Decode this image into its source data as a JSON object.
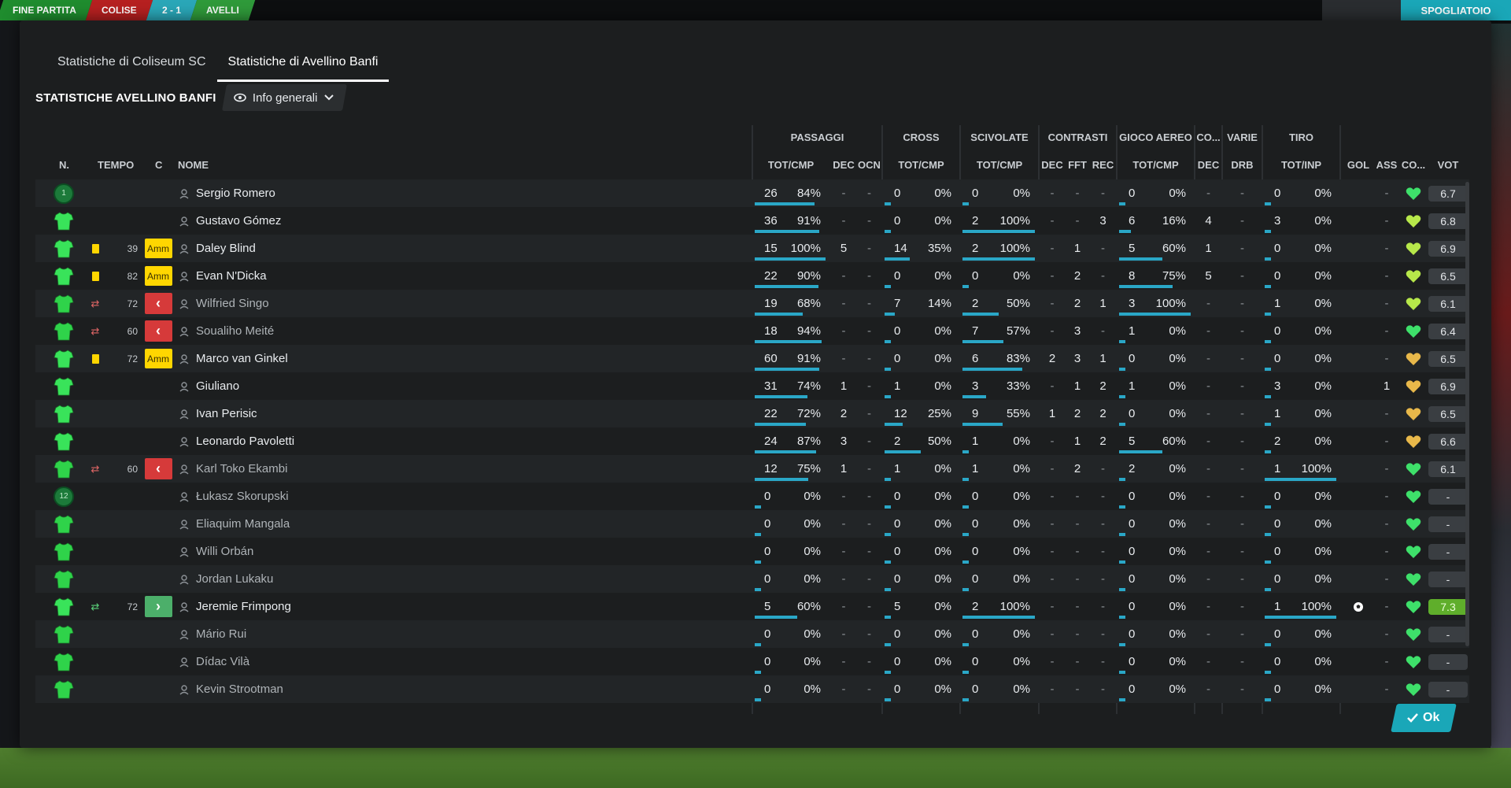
{
  "background": {
    "scoreboard": [
      "FINE PARTITA",
      "COLISE",
      "2 - 1",
      "AVELLI"
    ],
    "right_button": "SPOGLIATOIO"
  },
  "tabs": [
    {
      "label": "Statistiche di Coliseum SC",
      "active": false
    },
    {
      "label": "Statistiche di Avellino Banfi",
      "active": true
    }
  ],
  "section_title": "STATISTICHE AVELLINO BANFI",
  "view_dropdown": {
    "label": "Info generali"
  },
  "group_headers": {
    "passaggi": "PASSAGGI",
    "cross": "CROSS",
    "scivolate": "SCIVOLATE",
    "contrasti": "CONTRASTI",
    "gioco_aereo": "GIOCO AEREO",
    "co": "CO...",
    "varie": "VARIE",
    "tiro": "TIRO"
  },
  "column_headers": {
    "n": "N.",
    "tempo": "TEMPO",
    "c": "C",
    "nome": "NOME",
    "pass_totcmp": "TOT/CMP",
    "pass_dec": "DEC",
    "pass_ocn": "OCN",
    "cross_totcmp": "TOT/CMP",
    "sciv_totcmp": "TOT/CMP",
    "contr_dec": "DEC",
    "contr_fft": "FFT",
    "contr_rec": "REC",
    "aereo_totcmp": "TOT/CMP",
    "co_dec": "DEC",
    "varie_drb": "DRB",
    "tiro_totinp": "TOT/INP",
    "gol": "GOL",
    "ass": "ASS",
    "co2": "CO...",
    "vot": "VOT"
  },
  "players": [
    {
      "num": "1",
      "gk": true,
      "card": "",
      "minute": "",
      "badge": "",
      "name": "Sergio Romero",
      "pass": [
        "26",
        "84%"
      ],
      "pass_pct": 0.84,
      "pdec": "-",
      "ocn": "-",
      "cross": [
        "0",
        "0%"
      ],
      "cross_pct": 0,
      "sciv": [
        "0",
        "0%"
      ],
      "sciv_pct": 0,
      "cdec": "-",
      "fft": "-",
      "rec": "-",
      "aereo": [
        "0",
        "0%"
      ],
      "aereo_pct": 0,
      "codec": "-",
      "drb": "-",
      "tiro": [
        "0",
        "0%"
      ],
      "tiro_pct": 0,
      "gol": "",
      "ass": "-",
      "heart": "green",
      "vot": "6.7",
      "dim": false
    },
    {
      "num": "",
      "gk": false,
      "card": "",
      "minute": "",
      "badge": "",
      "name": "Gustavo Gómez",
      "pass": [
        "36",
        "91%"
      ],
      "pass_pct": 0.91,
      "pdec": "-",
      "ocn": "-",
      "cross": [
        "0",
        "0%"
      ],
      "cross_pct": 0,
      "sciv": [
        "2",
        "100%"
      ],
      "sciv_pct": 1,
      "cdec": "-",
      "fft": "-",
      "rec": "3",
      "aereo": [
        "6",
        "16%"
      ],
      "aereo_pct": 0.16,
      "codec": "4",
      "drb": "-",
      "tiro": [
        "3",
        "0%"
      ],
      "tiro_pct": 0,
      "gol": "",
      "ass": "-",
      "heart": "lime",
      "vot": "6.8",
      "dim": false
    },
    {
      "num": "",
      "gk": false,
      "card": "yellow",
      "minute": "39",
      "badge": "Amm",
      "name": "Daley Blind",
      "pass": [
        "15",
        "100%"
      ],
      "pass_pct": 1,
      "pdec": "5",
      "ocn": "-",
      "cross": [
        "14",
        "35%"
      ],
      "cross_pct": 0.35,
      "sciv": [
        "2",
        "100%"
      ],
      "sciv_pct": 1,
      "cdec": "-",
      "fft": "1",
      "rec": "-",
      "aereo": [
        "5",
        "60%"
      ],
      "aereo_pct": 0.6,
      "codec": "1",
      "drb": "-",
      "tiro": [
        "0",
        "0%"
      ],
      "tiro_pct": 0,
      "gol": "",
      "ass": "-",
      "heart": "lime",
      "vot": "6.9",
      "dim": false
    },
    {
      "num": "",
      "gk": false,
      "card": "yellow",
      "minute": "82",
      "badge": "Amm",
      "name": "Evan N'Dicka",
      "pass": [
        "22",
        "90%"
      ],
      "pass_pct": 0.9,
      "pdec": "-",
      "ocn": "-",
      "cross": [
        "0",
        "0%"
      ],
      "cross_pct": 0,
      "sciv": [
        "0",
        "0%"
      ],
      "sciv_pct": 0,
      "cdec": "-",
      "fft": "2",
      "rec": "-",
      "aereo": [
        "8",
        "75%"
      ],
      "aereo_pct": 0.75,
      "codec": "5",
      "drb": "-",
      "tiro": [
        "0",
        "0%"
      ],
      "tiro_pct": 0,
      "gol": "",
      "ass": "-",
      "heart": "lime",
      "vot": "6.5",
      "dim": false
    },
    {
      "num": "",
      "gk": false,
      "card": "subout",
      "minute": "72",
      "badge": "out",
      "name": "Wilfried Singo",
      "pass": [
        "19",
        "68%"
      ],
      "pass_pct": 0.68,
      "pdec": "-",
      "ocn": "-",
      "cross": [
        "7",
        "14%"
      ],
      "cross_pct": 0.14,
      "sciv": [
        "2",
        "50%"
      ],
      "sciv_pct": 0.5,
      "cdec": "-",
      "fft": "2",
      "rec": "1",
      "aereo": [
        "3",
        "100%"
      ],
      "aereo_pct": 1,
      "codec": "-",
      "drb": "-",
      "tiro": [
        "1",
        "0%"
      ],
      "tiro_pct": 0,
      "gol": "",
      "ass": "-",
      "heart": "lime",
      "vot": "6.1",
      "dim": true
    },
    {
      "num": "",
      "gk": false,
      "card": "subout",
      "minute": "60",
      "badge": "out",
      "name": "Soualiho Meité",
      "pass": [
        "18",
        "94%"
      ],
      "pass_pct": 0.94,
      "pdec": "-",
      "ocn": "-",
      "cross": [
        "0",
        "0%"
      ],
      "cross_pct": 0,
      "sciv": [
        "7",
        "57%"
      ],
      "sciv_pct": 0.57,
      "cdec": "-",
      "fft": "3",
      "rec": "-",
      "aereo": [
        "1",
        "0%"
      ],
      "aereo_pct": 0,
      "codec": "-",
      "drb": "-",
      "tiro": [
        "0",
        "0%"
      ],
      "tiro_pct": 0,
      "gol": "",
      "ass": "-",
      "heart": "green",
      "vot": "6.4",
      "dim": true
    },
    {
      "num": "",
      "gk": false,
      "card": "yellow",
      "minute": "72",
      "badge": "Amm",
      "name": "Marco van Ginkel",
      "pass": [
        "60",
        "91%"
      ],
      "pass_pct": 0.91,
      "pdec": "-",
      "ocn": "-",
      "cross": [
        "0",
        "0%"
      ],
      "cross_pct": 0,
      "sciv": [
        "6",
        "83%"
      ],
      "sciv_pct": 0.83,
      "cdec": "2",
      "fft": "3",
      "rec": "1",
      "aereo": [
        "0",
        "0%"
      ],
      "aereo_pct": 0,
      "codec": "-",
      "drb": "-",
      "tiro": [
        "0",
        "0%"
      ],
      "tiro_pct": 0,
      "gol": "",
      "ass": "-",
      "heart": "gold",
      "vot": "6.5",
      "dim": false
    },
    {
      "num": "",
      "gk": false,
      "card": "",
      "minute": "",
      "badge": "",
      "name": "Giuliano",
      "pass": [
        "31",
        "74%"
      ],
      "pass_pct": 0.74,
      "pdec": "1",
      "ocn": "-",
      "cross": [
        "1",
        "0%"
      ],
      "cross_pct": 0,
      "sciv": [
        "3",
        "33%"
      ],
      "sciv_pct": 0.33,
      "cdec": "-",
      "fft": "1",
      "rec": "2",
      "aereo": [
        "1",
        "0%"
      ],
      "aereo_pct": 0,
      "codec": "-",
      "drb": "-",
      "tiro": [
        "3",
        "0%"
      ],
      "tiro_pct": 0,
      "gol": "",
      "ass": "1",
      "heart": "gold",
      "vot": "6.9",
      "dim": false
    },
    {
      "num": "",
      "gk": false,
      "card": "",
      "minute": "",
      "badge": "",
      "name": "Ivan Perisic",
      "pass": [
        "22",
        "72%"
      ],
      "pass_pct": 0.72,
      "pdec": "2",
      "ocn": "-",
      "cross": [
        "12",
        "25%"
      ],
      "cross_pct": 0.25,
      "sciv": [
        "9",
        "55%"
      ],
      "sciv_pct": 0.55,
      "cdec": "1",
      "fft": "2",
      "rec": "2",
      "aereo": [
        "0",
        "0%"
      ],
      "aereo_pct": 0,
      "codec": "-",
      "drb": "-",
      "tiro": [
        "1",
        "0%"
      ],
      "tiro_pct": 0,
      "gol": "",
      "ass": "-",
      "heart": "gold",
      "vot": "6.5",
      "dim": false
    },
    {
      "num": "",
      "gk": false,
      "card": "",
      "minute": "",
      "badge": "",
      "name": "Leonardo Pavoletti",
      "pass": [
        "24",
        "87%"
      ],
      "pass_pct": 0.87,
      "pdec": "3",
      "ocn": "-",
      "cross": [
        "2",
        "50%"
      ],
      "cross_pct": 0.5,
      "sciv": [
        "1",
        "0%"
      ],
      "sciv_pct": 0,
      "cdec": "-",
      "fft": "1",
      "rec": "2",
      "aereo": [
        "5",
        "60%"
      ],
      "aereo_pct": 0.6,
      "codec": "-",
      "drb": "-",
      "tiro": [
        "2",
        "0%"
      ],
      "tiro_pct": 0,
      "gol": "",
      "ass": "-",
      "heart": "gold",
      "vot": "6.6",
      "dim": false
    },
    {
      "num": "",
      "gk": false,
      "card": "subout",
      "minute": "60",
      "badge": "out",
      "name": "Karl Toko Ekambi",
      "pass": [
        "12",
        "75%"
      ],
      "pass_pct": 0.75,
      "pdec": "1",
      "ocn": "-",
      "cross": [
        "1",
        "0%"
      ],
      "cross_pct": 0,
      "sciv": [
        "1",
        "0%"
      ],
      "sciv_pct": 0,
      "cdec": "-",
      "fft": "2",
      "rec": "-",
      "aereo": [
        "2",
        "0%"
      ],
      "aereo_pct": 0,
      "codec": "-",
      "drb": "-",
      "tiro": [
        "1",
        "100%"
      ],
      "tiro_pct": 1,
      "gol": "",
      "ass": "-",
      "heart": "green",
      "vot": "6.1",
      "dim": true
    },
    {
      "num": "12",
      "gk": true,
      "card": "",
      "minute": "",
      "badge": "",
      "name": "Łukasz Skorupski",
      "pass": [
        "0",
        "0%"
      ],
      "pass_pct": 0,
      "pdec": "-",
      "ocn": "-",
      "cross": [
        "0",
        "0%"
      ],
      "cross_pct": 0,
      "sciv": [
        "0",
        "0%"
      ],
      "sciv_pct": 0,
      "cdec": "-",
      "fft": "-",
      "rec": "-",
      "aereo": [
        "0",
        "0%"
      ],
      "aereo_pct": 0,
      "codec": "-",
      "drb": "-",
      "tiro": [
        "0",
        "0%"
      ],
      "tiro_pct": 0,
      "gol": "",
      "ass": "-",
      "heart": "green",
      "vot": "-",
      "dim": true
    },
    {
      "num": "",
      "gk": false,
      "card": "",
      "minute": "",
      "badge": "",
      "name": "Eliaquim Mangala",
      "pass": [
        "0",
        "0%"
      ],
      "pass_pct": 0,
      "pdec": "-",
      "ocn": "-",
      "cross": [
        "0",
        "0%"
      ],
      "cross_pct": 0,
      "sciv": [
        "0",
        "0%"
      ],
      "sciv_pct": 0,
      "cdec": "-",
      "fft": "-",
      "rec": "-",
      "aereo": [
        "0",
        "0%"
      ],
      "aereo_pct": 0,
      "codec": "-",
      "drb": "-",
      "tiro": [
        "0",
        "0%"
      ],
      "tiro_pct": 0,
      "gol": "",
      "ass": "-",
      "heart": "green",
      "vot": "-",
      "dim": true
    },
    {
      "num": "",
      "gk": false,
      "card": "",
      "minute": "",
      "badge": "",
      "name": "Willi Orbán",
      "pass": [
        "0",
        "0%"
      ],
      "pass_pct": 0,
      "pdec": "-",
      "ocn": "-",
      "cross": [
        "0",
        "0%"
      ],
      "cross_pct": 0,
      "sciv": [
        "0",
        "0%"
      ],
      "sciv_pct": 0,
      "cdec": "-",
      "fft": "-",
      "rec": "-",
      "aereo": [
        "0",
        "0%"
      ],
      "aereo_pct": 0,
      "codec": "-",
      "drb": "-",
      "tiro": [
        "0",
        "0%"
      ],
      "tiro_pct": 0,
      "gol": "",
      "ass": "-",
      "heart": "green",
      "vot": "-",
      "dim": true
    },
    {
      "num": "",
      "gk": false,
      "card": "",
      "minute": "",
      "badge": "",
      "name": "Jordan Lukaku",
      "pass": [
        "0",
        "0%"
      ],
      "pass_pct": 0,
      "pdec": "-",
      "ocn": "-",
      "cross": [
        "0",
        "0%"
      ],
      "cross_pct": 0,
      "sciv": [
        "0",
        "0%"
      ],
      "sciv_pct": 0,
      "cdec": "-",
      "fft": "-",
      "rec": "-",
      "aereo": [
        "0",
        "0%"
      ],
      "aereo_pct": 0,
      "codec": "-",
      "drb": "-",
      "tiro": [
        "0",
        "0%"
      ],
      "tiro_pct": 0,
      "gol": "",
      "ass": "-",
      "heart": "green",
      "vot": "-",
      "dim": true
    },
    {
      "num": "",
      "gk": false,
      "card": "subin",
      "minute": "72",
      "badge": "in",
      "name": "Jeremie Frimpong",
      "pass": [
        "5",
        "60%"
      ],
      "pass_pct": 0.6,
      "pdec": "-",
      "ocn": "-",
      "cross": [
        "5",
        "0%"
      ],
      "cross_pct": 0,
      "sciv": [
        "2",
        "100%"
      ],
      "sciv_pct": 1,
      "cdec": "-",
      "fft": "-",
      "rec": "-",
      "aereo": [
        "0",
        "0%"
      ],
      "aereo_pct": 0,
      "codec": "-",
      "drb": "-",
      "tiro": [
        "1",
        "100%"
      ],
      "tiro_pct": 1,
      "gol": "ball",
      "ass": "-",
      "heart": "green",
      "vot": "7.3",
      "dim": false,
      "best": true
    },
    {
      "num": "",
      "gk": false,
      "card": "",
      "minute": "",
      "badge": "",
      "name": "Mário Rui",
      "pass": [
        "0",
        "0%"
      ],
      "pass_pct": 0,
      "pdec": "-",
      "ocn": "-",
      "cross": [
        "0",
        "0%"
      ],
      "cross_pct": 0,
      "sciv": [
        "0",
        "0%"
      ],
      "sciv_pct": 0,
      "cdec": "-",
      "fft": "-",
      "rec": "-",
      "aereo": [
        "0",
        "0%"
      ],
      "aereo_pct": 0,
      "codec": "-",
      "drb": "-",
      "tiro": [
        "0",
        "0%"
      ],
      "tiro_pct": 0,
      "gol": "",
      "ass": "-",
      "heart": "green",
      "vot": "-",
      "dim": true
    },
    {
      "num": "",
      "gk": false,
      "card": "",
      "minute": "",
      "badge": "",
      "name": "Dídac Vilà",
      "pass": [
        "0",
        "0%"
      ],
      "pass_pct": 0,
      "pdec": "-",
      "ocn": "-",
      "cross": [
        "0",
        "0%"
      ],
      "cross_pct": 0,
      "sciv": [
        "0",
        "0%"
      ],
      "sciv_pct": 0,
      "cdec": "-",
      "fft": "-",
      "rec": "-",
      "aereo": [
        "0",
        "0%"
      ],
      "aereo_pct": 0,
      "codec": "-",
      "drb": "-",
      "tiro": [
        "0",
        "0%"
      ],
      "tiro_pct": 0,
      "gol": "",
      "ass": "-",
      "heart": "green",
      "vot": "-",
      "dim": true
    },
    {
      "num": "",
      "gk": false,
      "card": "",
      "minute": "",
      "badge": "",
      "name": "Kevin Strootman",
      "pass": [
        "0",
        "0%"
      ],
      "pass_pct": 0,
      "pdec": "-",
      "ocn": "-",
      "cross": [
        "0",
        "0%"
      ],
      "cross_pct": 0,
      "sciv": [
        "0",
        "0%"
      ],
      "sciv_pct": 0,
      "cdec": "-",
      "fft": "-",
      "rec": "-",
      "aereo": [
        "0",
        "0%"
      ],
      "aereo_pct": 0,
      "codec": "-",
      "drb": "-",
      "tiro": [
        "0",
        "0%"
      ],
      "tiro_pct": 0,
      "gol": "",
      "ass": "-",
      "heart": "green",
      "vot": "-",
      "dim": true
    }
  ],
  "ok_button": "Ok",
  "colors": {
    "accent": "#1aa7b8",
    "bar": "#2aa7c7",
    "yellow_card": "#ffd600",
    "sub_out": "#d63a3a",
    "sub_in": "#4caf6a",
    "best_rating": "#5fae2b"
  }
}
